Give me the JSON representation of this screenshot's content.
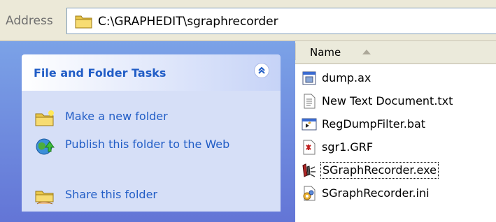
{
  "address": {
    "label": "Address",
    "path": "C:\\GRAPHEDIT\\sgraphrecorder"
  },
  "task_pane": {
    "title": "File and Folder Tasks",
    "items": [
      {
        "label": "Make a new folder",
        "icon": "new-folder-icon"
      },
      {
        "label": "Publish this folder to the Web",
        "icon": "publish-web-icon"
      },
      {
        "label": "Share this folder",
        "icon": "share-folder-icon"
      }
    ]
  },
  "file_list": {
    "column_name": "Name",
    "files": [
      {
        "name": "dump.ax",
        "icon": "system-file-icon"
      },
      {
        "name": "New Text Document.txt",
        "icon": "text-file-icon"
      },
      {
        "name": "RegDumpFilter.bat",
        "icon": "batch-file-icon"
      },
      {
        "name": "sgr1.GRF",
        "icon": "graph-file-icon"
      },
      {
        "name": "SGraphRecorder.exe",
        "icon": "exe-file-icon",
        "focused": true
      },
      {
        "name": "SGraphRecorder.ini",
        "icon": "ini-file-icon"
      }
    ]
  },
  "colors": {
    "task_pane_top": "#7ba2e7",
    "task_pane_bottom": "#6375d6",
    "task_link": "#215dc6",
    "task_body": "#d6dff7"
  }
}
